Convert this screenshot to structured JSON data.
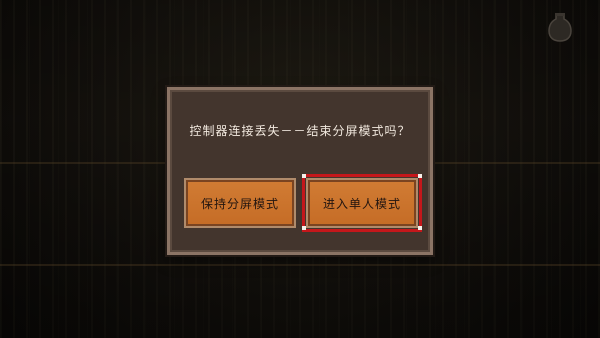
{
  "dialog": {
    "message": "控制器连接丢失－－结束分屏模式吗？",
    "buttons": {
      "keep_split_screen": "保持分屏模式",
      "single_player": "进入单人模式"
    },
    "selected_button": "single_player"
  },
  "theme": {
    "panel_bg": "#43352d",
    "panel_border": "#8b7465",
    "button_orange": "#c56c26",
    "selected_outline": "#c4171b"
  },
  "icons": {
    "hud_vessel": "vessel-icon"
  }
}
